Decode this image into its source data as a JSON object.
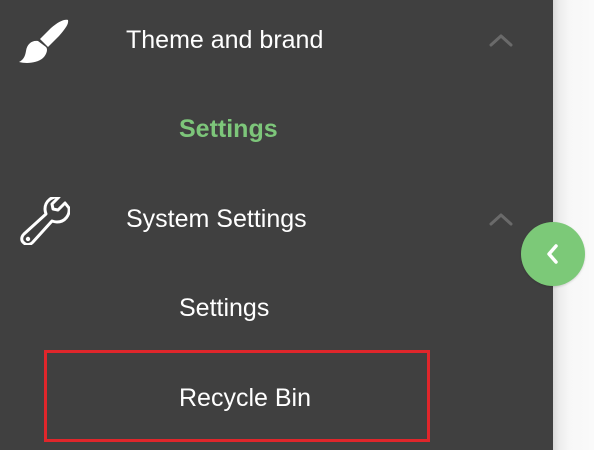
{
  "sidebar": {
    "sections": [
      {
        "label": "Theme and brand",
        "icon": "paintbrush-icon",
        "expanded": true,
        "items": [
          {
            "label": "Settings",
            "active": true
          }
        ]
      },
      {
        "label": "System Settings",
        "icon": "wrench-icon",
        "expanded": true,
        "items": [
          {
            "label": "Settings",
            "active": false
          },
          {
            "label": "Recycle Bin",
            "active": false,
            "highlighted": true
          }
        ]
      }
    ]
  },
  "collapse_button": {
    "icon": "chevron-left-icon"
  },
  "colors": {
    "sidebar_bg": "#404040",
    "active_item": "#7dc67a",
    "accent_button": "#7cc978",
    "highlight_border": "#e0262b",
    "chevron": "#6a6a6a"
  }
}
